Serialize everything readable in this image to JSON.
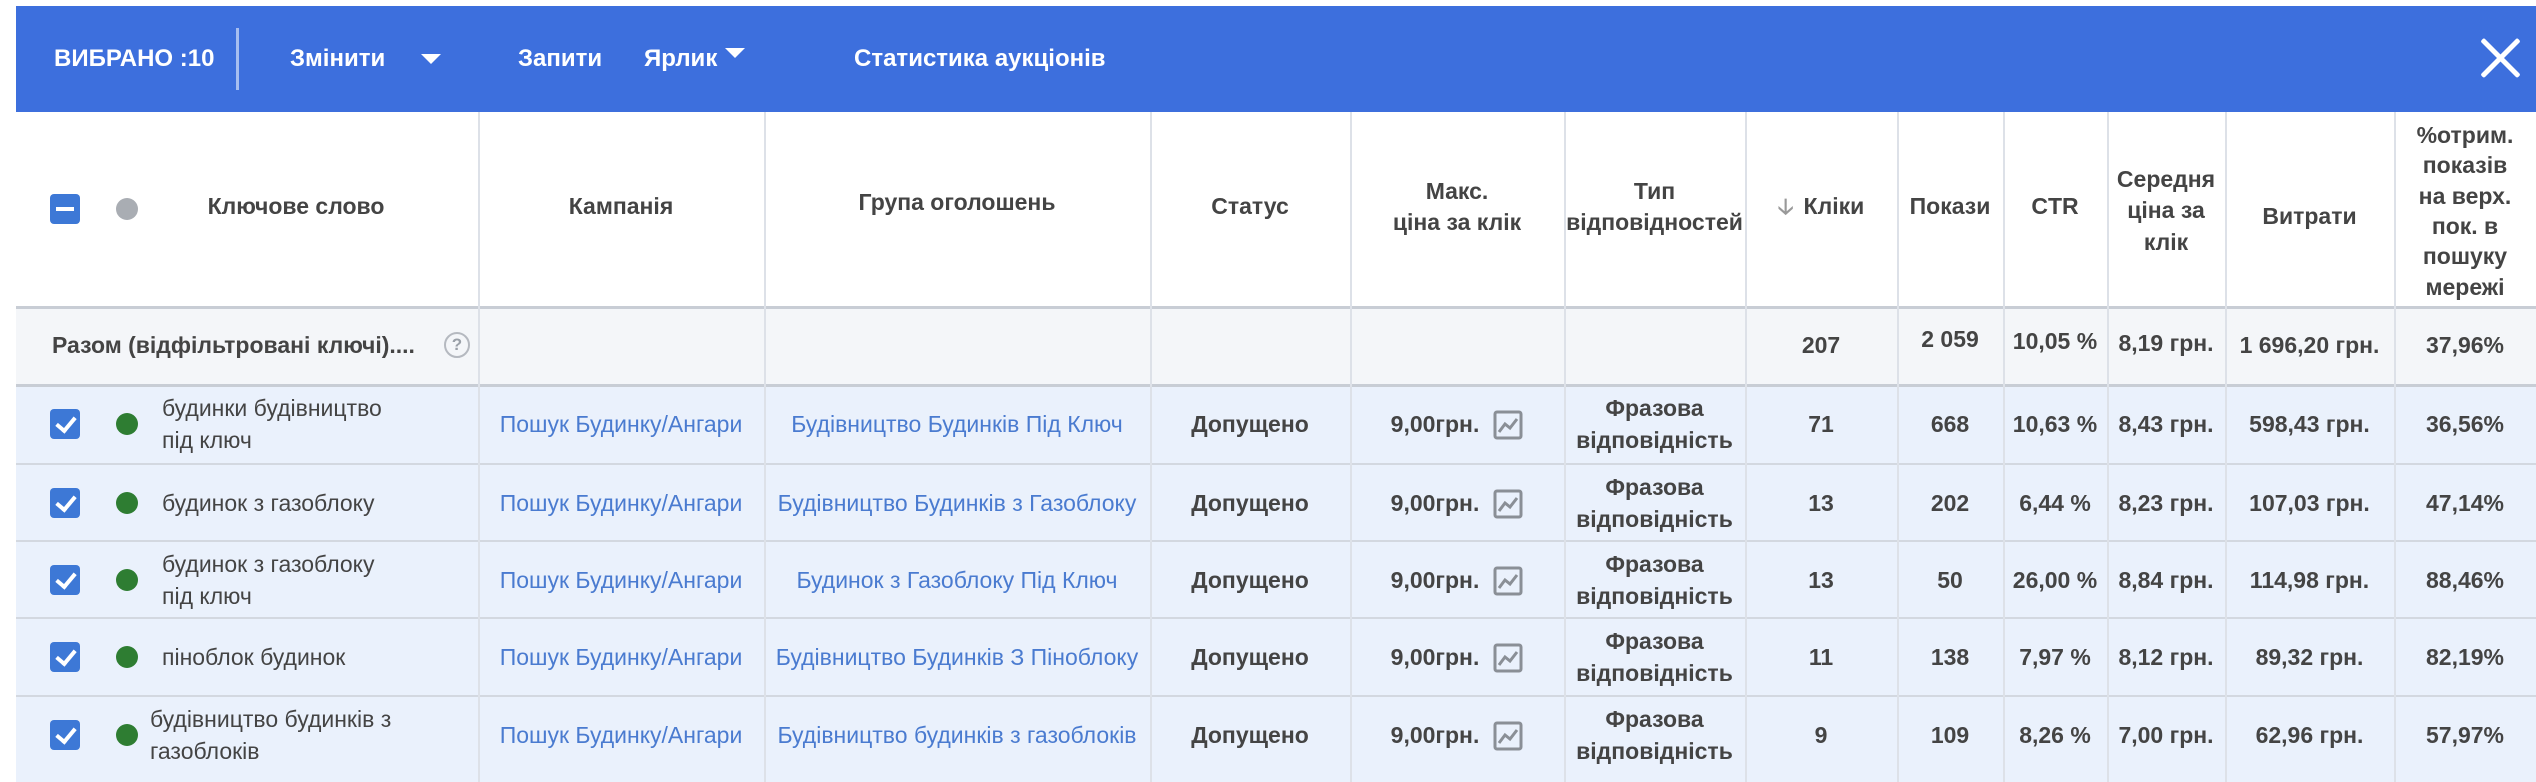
{
  "toolbar": {
    "selected": "ВИБРАНО :10",
    "edit": "Змінити",
    "queries": "Запити",
    "label": "Ярлик",
    "auction_stats": "Статистика аукціонів"
  },
  "colors": {
    "toolbar": "#3d6fdd",
    "link": "#4a7bd0",
    "enabled": "#2e7d32",
    "row_bg": "#eaf1fc"
  },
  "columns": {
    "keyword": "Ключове слово",
    "campaign": "Кампанія",
    "ad_group": "Група оголошень",
    "status": "Статус",
    "max_cpc_1": "Макс.",
    "max_cpc_2": "ціна за клік",
    "match_1": "Тип",
    "match_2": "відповідностей",
    "clicks": "Кліки",
    "impressions": "Покази",
    "ctr": "CTR",
    "avg_cpc_1": "Середня",
    "avg_cpc_2": "ціна за",
    "avg_cpc_3": "клік",
    "cost": "Витрати",
    "top_1": "%отрим.",
    "top_2": "показів",
    "top_3": "на верх.",
    "top_4": "пок. в",
    "top_5": "пошуку",
    "top_6": "мережі"
  },
  "total": {
    "label": "Разом (відфільтровані ключі)....",
    "help_icon": "?",
    "clicks": "207",
    "impressions": "2 059",
    "ctr": "10,05 %",
    "avg_cpc": "8,19 грн.",
    "cost": "1 696,20 грн.",
    "top": "37,96%"
  },
  "rows": [
    {
      "kw1": "будинки будівництво",
      "kw2": "під ключ",
      "campaign": "Пошук Будинку/Ангари",
      "group": "Будівництво Будинків Під Ключ",
      "status": "Допущено",
      "max_cpc": "9,00грн.",
      "m1": "Фразова",
      "m2": "відповідність",
      "clicks": "71",
      "impr": "668",
      "ctr": "10,63 %",
      "avg": "8,43 грн.",
      "cost": "598,43 грн.",
      "top": "36,56%"
    },
    {
      "kw1": "будинок з газоблоку",
      "kw2": "",
      "campaign": "Пошук Будинку/Ангари",
      "group": "Будівництво Будинків з Газоблоку",
      "status": "Допущено",
      "max_cpc": "9,00грн.",
      "m1": "Фразова",
      "m2": "відповідність",
      "clicks": "13",
      "impr": "202",
      "ctr": "6,44 %",
      "avg": "8,23 грн.",
      "cost": "107,03 грн.",
      "top": "47,14%"
    },
    {
      "kw1": "будинок з газоблоку",
      "kw2": "під ключ",
      "campaign": "Пошук Будинку/Ангари",
      "group": "Будинок з Газоблоку Під  Ключ",
      "status": "Допущено",
      "max_cpc": "9,00грн.",
      "m1": "Фразова",
      "m2": "відповідність",
      "clicks": "13",
      "impr": "50",
      "ctr": "26,00  %",
      "avg": "8,84 грн.",
      "cost": "114,98  грн.",
      "top": "88,46%"
    },
    {
      "kw1": "піноблок будинок",
      "kw2": "",
      "campaign": "Пошук Будинку/Ангари",
      "group": "Будівництво Будинків З Піноблоку",
      "status": "Допущено",
      "max_cpc": "9,00грн.",
      "m1": "Фразова",
      "m2": "відповідність",
      "clicks": "11",
      "impr": "138",
      "ctr": "7,97 %",
      "avg": "8,12 грн.",
      "cost": "89,32  грн.",
      "top": "82,19%"
    },
    {
      "kw1": "будівництво будинків з",
      "kw2": "газоблоків",
      "campaign": "Пошук Будинку/Ангари",
      "group": "Будівництво будинків з газоблоків",
      "status": "Допущено",
      "max_cpc": "9,00грн.",
      "m1": "Фразова",
      "m2": "відповідність",
      "clicks": "9",
      "impr": "109",
      "ctr": "8,26  %",
      "avg": "7,00 грн.",
      "cost": "62,96  грн.",
      "top": "57,97%"
    }
  ]
}
